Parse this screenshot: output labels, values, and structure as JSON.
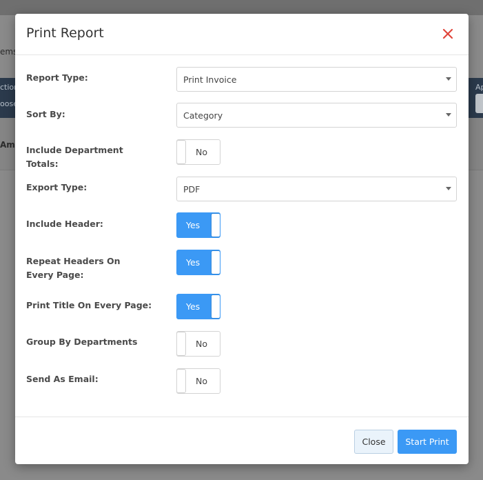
{
  "background": {
    "frag_items": "ems",
    "frag_action": "ction",
    "frag_choose": "oose",
    "frag_amst": "Amst",
    "frag_ap": "Ap"
  },
  "modal": {
    "title": "Print Report",
    "fields": {
      "report_type": {
        "label": "Report Type:",
        "value": "Print Invoice"
      },
      "sort_by": {
        "label": "Sort By:",
        "value": "Category"
      },
      "include_department_totals": {
        "label": "Include Department Totals:",
        "state": "No"
      },
      "export_type": {
        "label": "Export Type:",
        "value": "PDF"
      },
      "include_header": {
        "label": "Include Header:",
        "state": "Yes"
      },
      "repeat_headers": {
        "label": "Repeat Headers On Every Page:",
        "state": "Yes"
      },
      "print_title": {
        "label": "Print Title On Every Page:",
        "state": "Yes"
      },
      "group_by_departments": {
        "label": "Group By Departments",
        "state": "No"
      },
      "send_as_email": {
        "label": "Send As Email:",
        "state": "No"
      }
    },
    "footer": {
      "close_label": "Close",
      "start_print_label": "Start Print"
    }
  },
  "colors": {
    "primary": "#3b99f5",
    "close_icon": "#e0463c",
    "label_text": "#4a4a4a"
  }
}
